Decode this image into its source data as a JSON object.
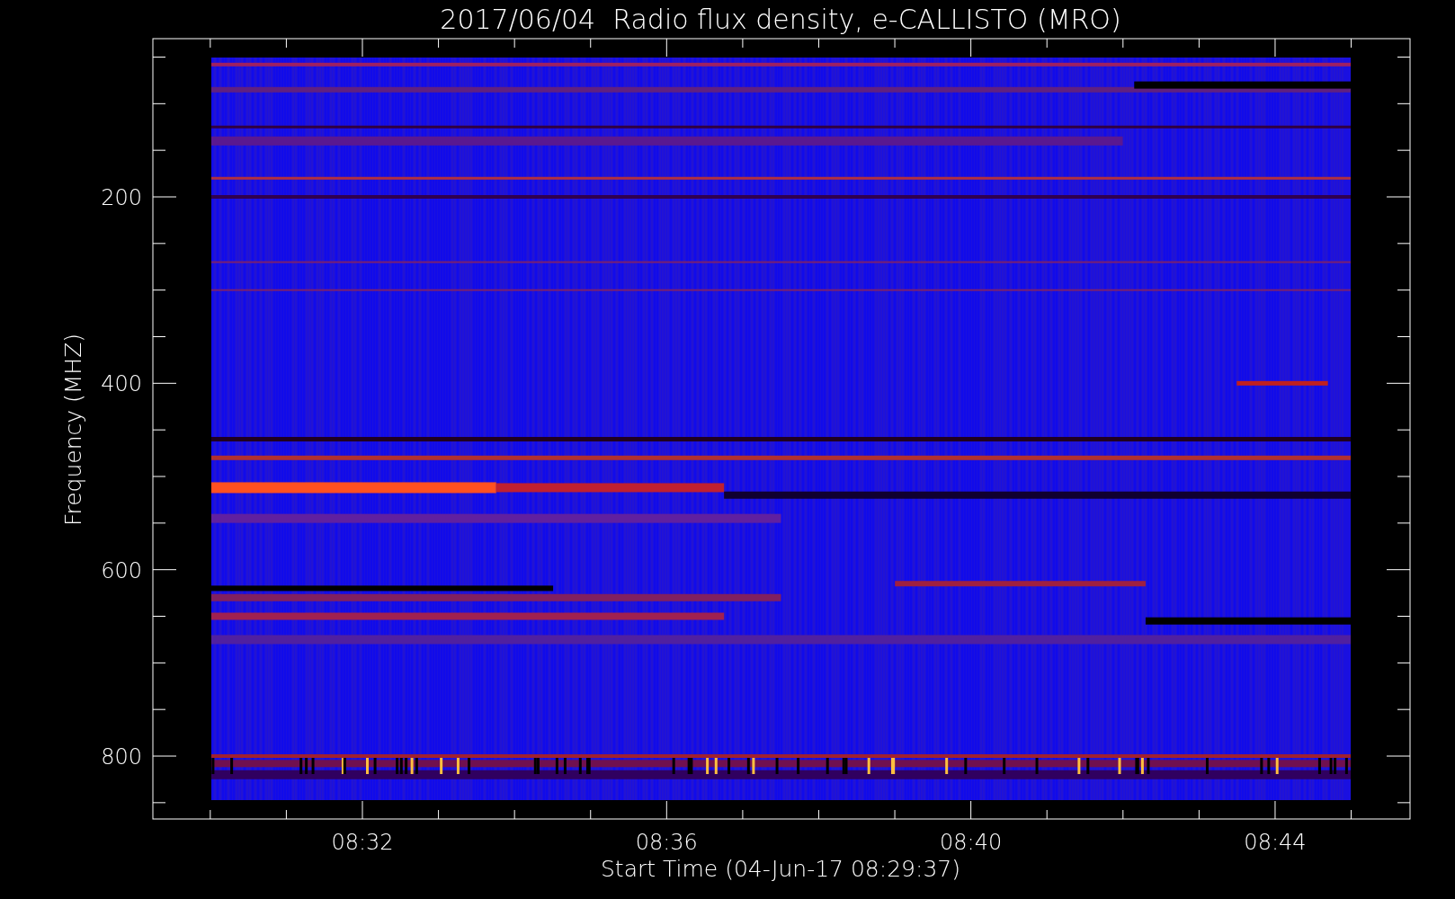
{
  "plot": {
    "title": "2017/06/04  Radio flux density, e-CALLISTO (MRO)",
    "ylabel": "Frequency (MHZ)",
    "xlabel": "Start Time (04-Jun-17 08:29:37)",
    "yticks": [
      "200",
      "400",
      "600",
      "800"
    ],
    "xticks": [
      "08:32",
      "08:36",
      "08:40",
      "08:44"
    ]
  }
}
